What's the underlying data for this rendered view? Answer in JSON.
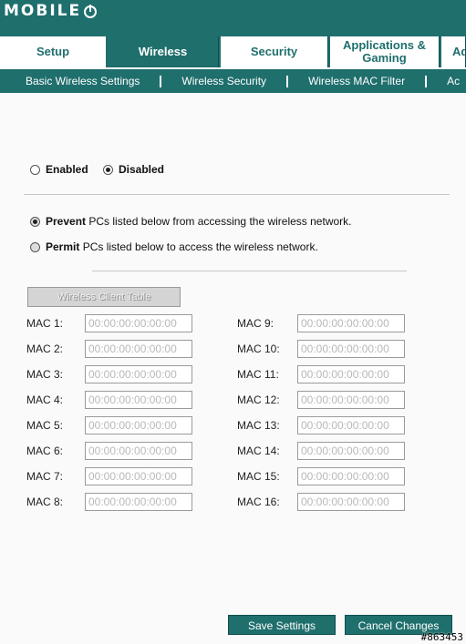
{
  "brand": {
    "logo_text": "MOBILE"
  },
  "tabs": [
    {
      "label": "Setup"
    },
    {
      "label": "Wireless"
    },
    {
      "label": "Security"
    },
    {
      "label": "Applications & Gaming"
    },
    {
      "label": "Ad"
    }
  ],
  "subnav": [
    {
      "label": "Basic Wireless Settings"
    },
    {
      "label": "Wireless Security"
    },
    {
      "label": "Wireless MAC Filter"
    },
    {
      "label": "Ac"
    }
  ],
  "filter": {
    "enabled_label": "Enabled",
    "disabled_label": "Disabled",
    "selected": "Disabled"
  },
  "mode": {
    "prevent_strong": "Prevent",
    "prevent_rest": "PCs listed below from accessing the wireless network.",
    "permit_strong": "Permit",
    "permit_rest": "PCs listed below to access the wireless network."
  },
  "client_table_button": "Wireless Client Table",
  "mac_left": [
    {
      "label": "MAC 1:",
      "value": "00:00:00:00:00:00"
    },
    {
      "label": "MAC 2:",
      "value": "00:00:00:00:00:00"
    },
    {
      "label": "MAC 3:",
      "value": "00:00:00:00:00:00"
    },
    {
      "label": "MAC 4:",
      "value": "00:00:00:00:00:00"
    },
    {
      "label": "MAC 5:",
      "value": "00:00:00:00:00:00"
    },
    {
      "label": "MAC 6:",
      "value": "00:00:00:00:00:00"
    },
    {
      "label": "MAC 7:",
      "value": "00:00:00:00:00:00"
    },
    {
      "label": "MAC 8:",
      "value": "00:00:00:00:00:00"
    }
  ],
  "mac_right": [
    {
      "label": "MAC 9:",
      "value": "00:00:00:00:00:00"
    },
    {
      "label": "MAC 10:",
      "value": "00:00:00:00:00:00"
    },
    {
      "label": "MAC 11:",
      "value": "00:00:00:00:00:00"
    },
    {
      "label": "MAC 12:",
      "value": "00:00:00:00:00:00"
    },
    {
      "label": "MAC 13:",
      "value": "00:00:00:00:00:00"
    },
    {
      "label": "MAC 14:",
      "value": "00:00:00:00:00:00"
    },
    {
      "label": "MAC 15:",
      "value": "00:00:00:00:00:00"
    },
    {
      "label": "MAC 16:",
      "value": "00:00:00:00:00:00"
    }
  ],
  "actions": {
    "save_label": "Save Settings",
    "cancel_label": "Cancel Changes"
  },
  "watermark": "#863453",
  "colors": {
    "brand": "#1f6f6d"
  }
}
